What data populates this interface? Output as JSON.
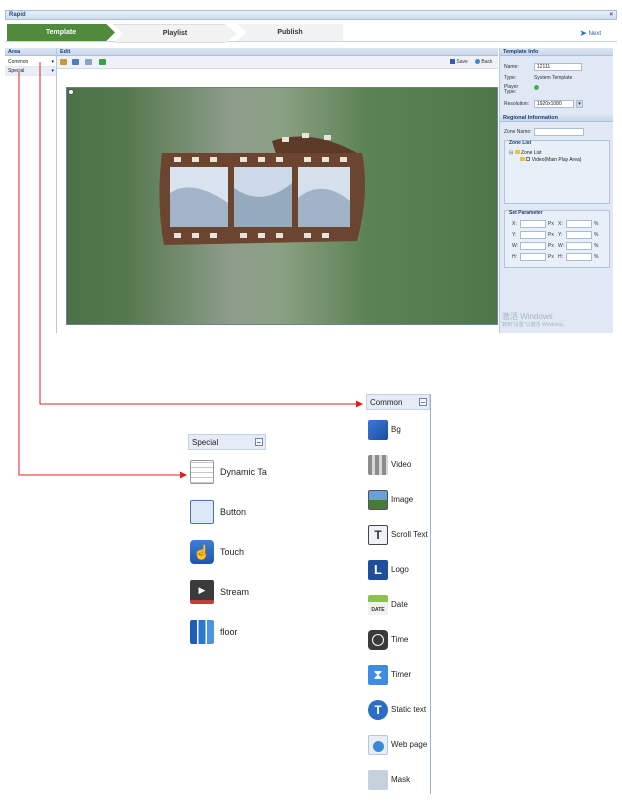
{
  "app": {
    "title": "Rapid",
    "close": "×"
  },
  "wizard": {
    "steps": [
      "Template",
      "Playlist",
      "Publish"
    ],
    "next": "Next"
  },
  "area": {
    "header": "Area",
    "items": [
      "Common",
      "Special"
    ]
  },
  "edit": {
    "header": "Edit",
    "save": "Save",
    "back": "Back"
  },
  "template_info": {
    "header": "Template Info",
    "name_label": "Name:",
    "name_value": "12111",
    "type_label": "Type:",
    "type_value": "System Template",
    "player_type_label": "Player Type:",
    "resolution_label": "Resolution:",
    "resolution_value": "1920x1080"
  },
  "regional": {
    "header": "Regional Information",
    "zone_name_label": "Zone Name:",
    "zone_list_title": "Zone List",
    "tree_root": "Zone List",
    "tree_child": "Video(Main Play Area)"
  },
  "set_parameter": {
    "title": "Set Parameter",
    "labels": [
      "X:",
      "Y:",
      "W:",
      "H:"
    ],
    "unit_px": "Px",
    "unit_pct": "%"
  },
  "watermark": {
    "line1": "激活 Windows",
    "line2": "转到\"设置\"以激活 Windows。"
  },
  "common_palette": {
    "header": "Common",
    "items": [
      {
        "label": "Bg",
        "icon": "bg-icon"
      },
      {
        "label": "Video",
        "icon": "video-icon"
      },
      {
        "label": "Image",
        "icon": "image-icon"
      },
      {
        "label": "Scroll Text",
        "icon": "scroll-text-icon"
      },
      {
        "label": "Logo",
        "icon": "logo-icon"
      },
      {
        "label": "Date",
        "icon": "date-icon"
      },
      {
        "label": "Time",
        "icon": "time-icon"
      },
      {
        "label": "Timer",
        "icon": "timer-icon"
      },
      {
        "label": "Static text",
        "icon": "static-text-icon"
      },
      {
        "label": "Web page",
        "icon": "web-page-icon"
      },
      {
        "label": "Mask",
        "icon": "mask-icon"
      }
    ]
  },
  "special_palette": {
    "header": "Special",
    "items": [
      {
        "label": "Dynamic Ta",
        "icon": "dynamic-table-icon"
      },
      {
        "label": "Button",
        "icon": "button-icon"
      },
      {
        "label": "Touch",
        "icon": "touch-icon"
      },
      {
        "label": "Stream",
        "icon": "stream-icon"
      },
      {
        "label": "floor",
        "icon": "floor-icon"
      }
    ]
  },
  "colors": {
    "accent_green": "#4f8a3d",
    "header_blue": "#1d3f73",
    "arrow_red": "#e02020"
  }
}
